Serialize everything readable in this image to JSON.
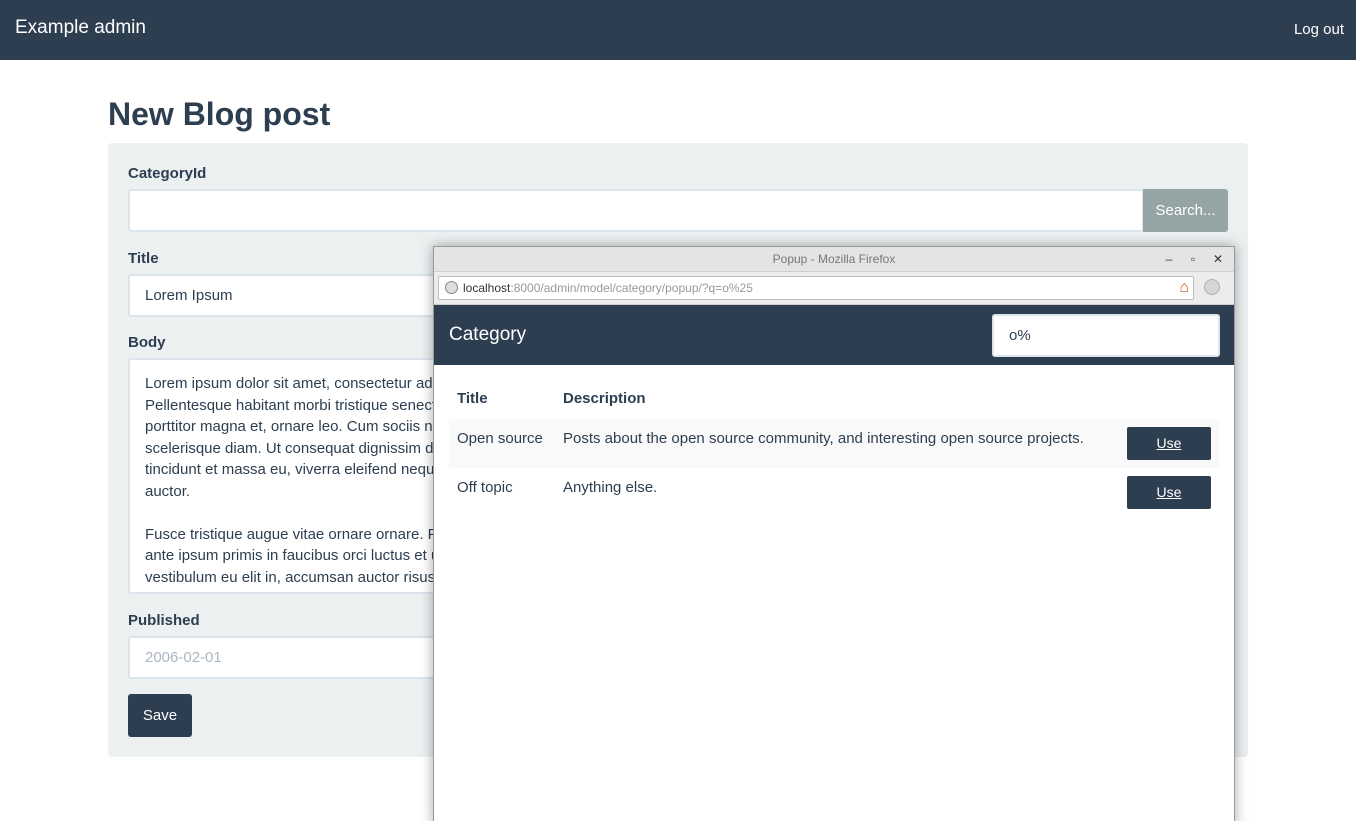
{
  "navbar": {
    "brand": "Example admin",
    "logout": "Log out"
  },
  "page": {
    "title_prefix": "New ",
    "title_strong": "Blog post"
  },
  "form": {
    "category_label": "CategoryId",
    "category_value": "",
    "search_button": "Search...",
    "title_label": "Title",
    "title_value": "Lorem Ipsum",
    "body_label": "Body",
    "body_paragraphs": [
      "Lorem ipsum dolor sit amet, consectetur adip\nPellentesque habitant morbi tristique senect\nporttitor magna et, ornare leo. Cum sociis na\nscelerisque diam. Ut consequat dignissim dia\ntincidunt et massa eu, viverra eleifend neque\nauctor.",
      "Fusce tristique augue vitae ornare ornare. Fu\nante ipsum primis in faucibus orci luctus et u\nvestibulum eu elit in, accumsan auctor risus."
    ],
    "published_label": "Published",
    "published_placeholder": "2006-02-01",
    "save_button": "Save"
  },
  "popup": {
    "window_title": "Popup - Mozilla Firefox",
    "controls": {
      "minimize": "–",
      "maximize": "▫",
      "close": "✕"
    },
    "url_host": "localhost",
    "url_rest": ":8000/admin/model/category/popup/?q=o%25",
    "header_title": "Category",
    "search_value": "o%",
    "columns": [
      "Title",
      "Description"
    ],
    "rows": [
      {
        "title": "Open source",
        "description": "Posts about the open source community, and interesting open source projects.",
        "action": "Use"
      },
      {
        "title": "Off topic",
        "description": "Anything else.",
        "action": "Use"
      }
    ]
  },
  "icons": {
    "home": "home-icon",
    "globe": "globe-icon",
    "extension": "search-engine-icon"
  },
  "colors": {
    "primary": "#2c3e50",
    "panel": "#ecf0f1",
    "search_button": "#95a5a6"
  }
}
